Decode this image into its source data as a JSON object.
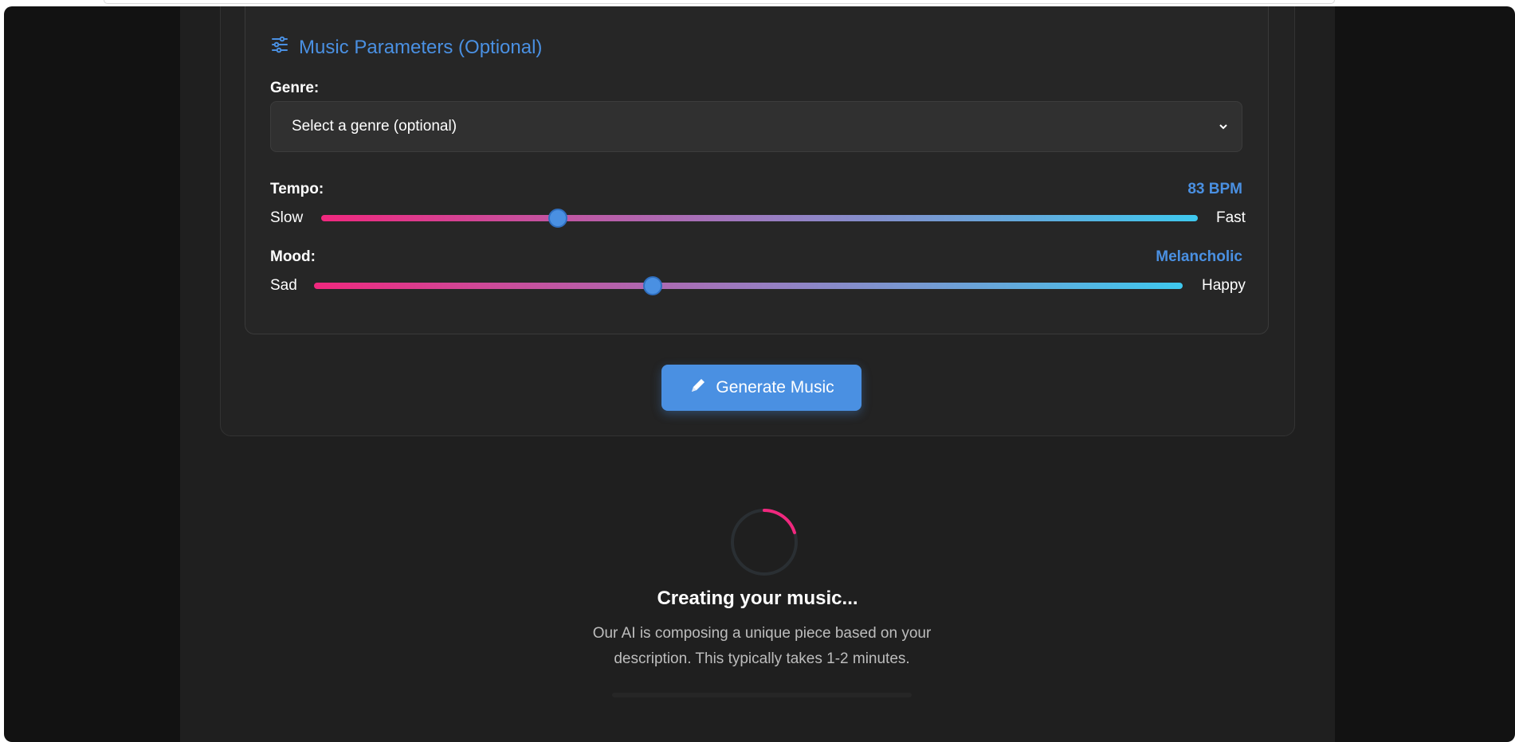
{
  "params": {
    "title": "Music Parameters (Optional)",
    "genre": {
      "label": "Genre:",
      "placeholder": "Select a genre (optional)"
    },
    "tempo": {
      "label": "Tempo:",
      "value_text": "83 BPM",
      "min_label": "Slow",
      "max_label": "Fast",
      "position_fraction": 0.27
    },
    "mood": {
      "label": "Mood:",
      "value_text": "Melancholic",
      "min_label": "Sad",
      "max_label": "Happy",
      "position_fraction": 0.39
    }
  },
  "generate_button": {
    "label": "Generate Music"
  },
  "loading": {
    "title": "Creating your music...",
    "description_line1": "Our AI is composing a unique piece based on your",
    "description_line2": "description. This typically takes 1-2 minutes."
  },
  "colors": {
    "accent": "#4a90e2",
    "track_start": "#f0287e",
    "track_end": "#3ec8ee",
    "spinner": "#f0287e"
  }
}
